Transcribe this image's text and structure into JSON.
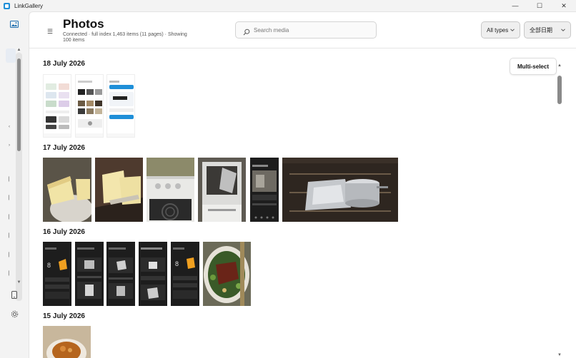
{
  "window": {
    "title": "LinkGallery",
    "controls": {
      "minimize": "—",
      "maximize": "☐",
      "close": "✕"
    }
  },
  "header": {
    "title": "Photos",
    "status": "Connected · full index 1,463 items (11 pages) · Showing 100 items",
    "search": {
      "placeholder": "Search media",
      "value": ""
    },
    "type_filter": {
      "selected": "All types"
    },
    "date_filter": {
      "selected": "全部日期"
    }
  },
  "toolbar": {
    "multi_select_label": "Multi-select"
  },
  "groups": [
    {
      "date": "18 July 2026",
      "items": [
        "screenshot",
        "screenshot",
        "screenshot"
      ]
    },
    {
      "date": "17 July 2026",
      "items": [
        "photo",
        "photo",
        "photo",
        "photo",
        "screenshot",
        "photo"
      ]
    },
    {
      "date": "16 July 2026",
      "items": [
        "screenshot",
        "screenshot",
        "screenshot",
        "screenshot",
        "screenshot",
        "photo"
      ]
    },
    {
      "date": "15 July 2026",
      "items": [
        "photo"
      ]
    }
  ],
  "colors": {
    "accent": "#1f8fd8",
    "dark_screen": "#1d1d1d",
    "orange_accent": "#f0a020"
  }
}
